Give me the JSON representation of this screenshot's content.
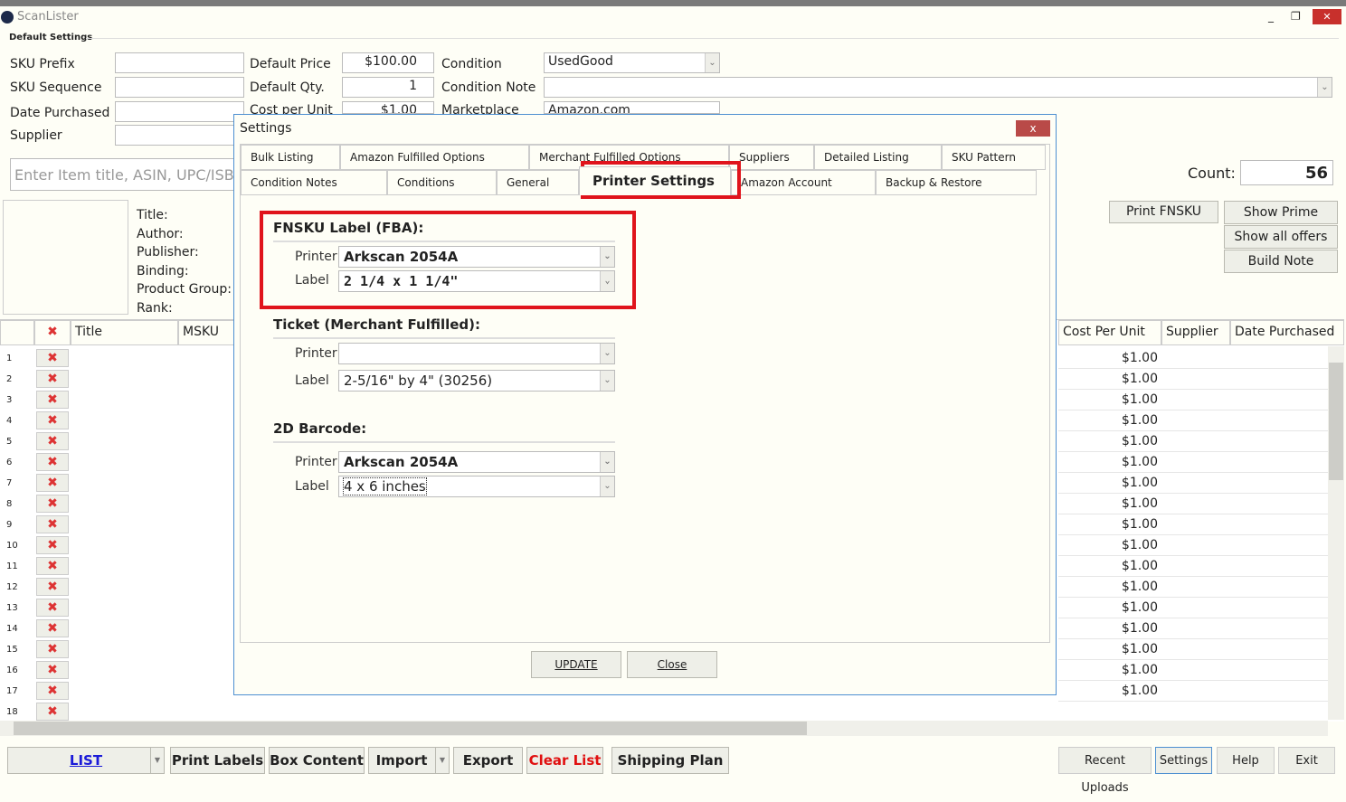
{
  "app": {
    "title": "ScanLister",
    "minimize": "_",
    "restore": "❐",
    "close": "✕"
  },
  "defaults": {
    "group_label": "Default Settings",
    "sku_prefix_label": "SKU Prefix",
    "sku_prefix": "",
    "sku_sequence_label": "SKU Sequence",
    "sku_sequence": "",
    "date_purchased_label": "Date Purchased",
    "date_purchased": "",
    "supplier_label": "Supplier",
    "supplier": "",
    "price_label": "Default Price",
    "price": "$100.00",
    "qty_label": "Default Qty.",
    "qty": "1",
    "cost_label": "Cost per Unit",
    "cost": "$1.00",
    "condition_label": "Condition",
    "condition": "UsedGood",
    "condition_note_label": "Condition Note",
    "condition_note": "",
    "marketplace_label": "Marketplace",
    "marketplace": "Amazon.com"
  },
  "search": {
    "placeholder": "Enter Item title, ASIN, UPC/ISBN/EAN"
  },
  "count": {
    "label": "Count:",
    "value": "56"
  },
  "details": {
    "title": "Title:",
    "author": "Author:",
    "publisher": "Publisher:",
    "binding": "Binding:",
    "product_group": "Product Group:",
    "rank": "Rank:"
  },
  "actions": {
    "print_fnsku": "Print FNSKU",
    "show_prime": "Show Prime",
    "show_all_offers": "Show all offers",
    "build_note": "Build Note"
  },
  "grid": {
    "columns_left": [
      "Title",
      "MSKU"
    ],
    "columns_right": [
      "Cost Per Unit",
      "Supplier",
      "Date Purchased"
    ],
    "rows": [
      {
        "n": "1",
        "cost": "$1.00"
      },
      {
        "n": "2",
        "cost": "$1.00"
      },
      {
        "n": "3",
        "cost": "$1.00"
      },
      {
        "n": "4",
        "cost": "$1.00"
      },
      {
        "n": "5",
        "cost": "$1.00"
      },
      {
        "n": "6",
        "cost": "$1.00"
      },
      {
        "n": "7",
        "cost": "$1.00"
      },
      {
        "n": "8",
        "cost": "$1.00"
      },
      {
        "n": "9",
        "cost": "$1.00"
      },
      {
        "n": "10",
        "cost": "$1.00"
      },
      {
        "n": "11",
        "cost": "$1.00"
      },
      {
        "n": "12",
        "cost": "$1.00"
      },
      {
        "n": "13",
        "cost": "$1.00"
      },
      {
        "n": "14",
        "cost": "$1.00"
      },
      {
        "n": "15",
        "cost": "$1.00"
      },
      {
        "n": "16",
        "cost": "$1.00"
      },
      {
        "n": "17",
        "cost": "$1.00"
      },
      {
        "n": "18",
        "cost": ""
      }
    ]
  },
  "toolbar": {
    "list": "LIST",
    "print_labels": "Print Labels",
    "box_content": "Box Content",
    "import": "Import",
    "export": "Export",
    "clear_list": "Clear List",
    "shipping_plan": "Shipping Plan",
    "recent_uploads": "Recent Uploads",
    "settings": "Settings",
    "help": "Help",
    "exit": "Exit"
  },
  "dialog": {
    "title": "Settings",
    "close": "x",
    "tabs_row1": [
      "Bulk Listing",
      "Amazon Fulfilled Options",
      "Merchant Fulfilled Options",
      "Suppliers",
      "Detailed Listing",
      "SKU Pattern"
    ],
    "tabs_row2": [
      "Condition Notes",
      "Conditions",
      "General",
      "Printer Settings",
      "Amazon Account",
      "Backup & Restore"
    ],
    "active_tab": "Printer Settings",
    "fnsku": {
      "title": "FNSKU Label (FBA):",
      "printer_label": "Printer",
      "printer": "Arkscan 2054A",
      "label_label": "Label",
      "label": "2 1/4 x 1 1/4\""
    },
    "ticket": {
      "title": "Ticket (Merchant Fulfilled):",
      "printer_label": "Printer",
      "printer": "",
      "label_label": "Label",
      "label": "2-5/16\" by 4\" (30256)"
    },
    "barcode": {
      "title": "2D Barcode:",
      "printer_label": "Printer",
      "printer": "Arkscan 2054A",
      "label_label": "Label",
      "label": "4 x 6 inches"
    },
    "update": "UPDATE",
    "close_button": "Close",
    "highlight_color": "#e0141c"
  }
}
